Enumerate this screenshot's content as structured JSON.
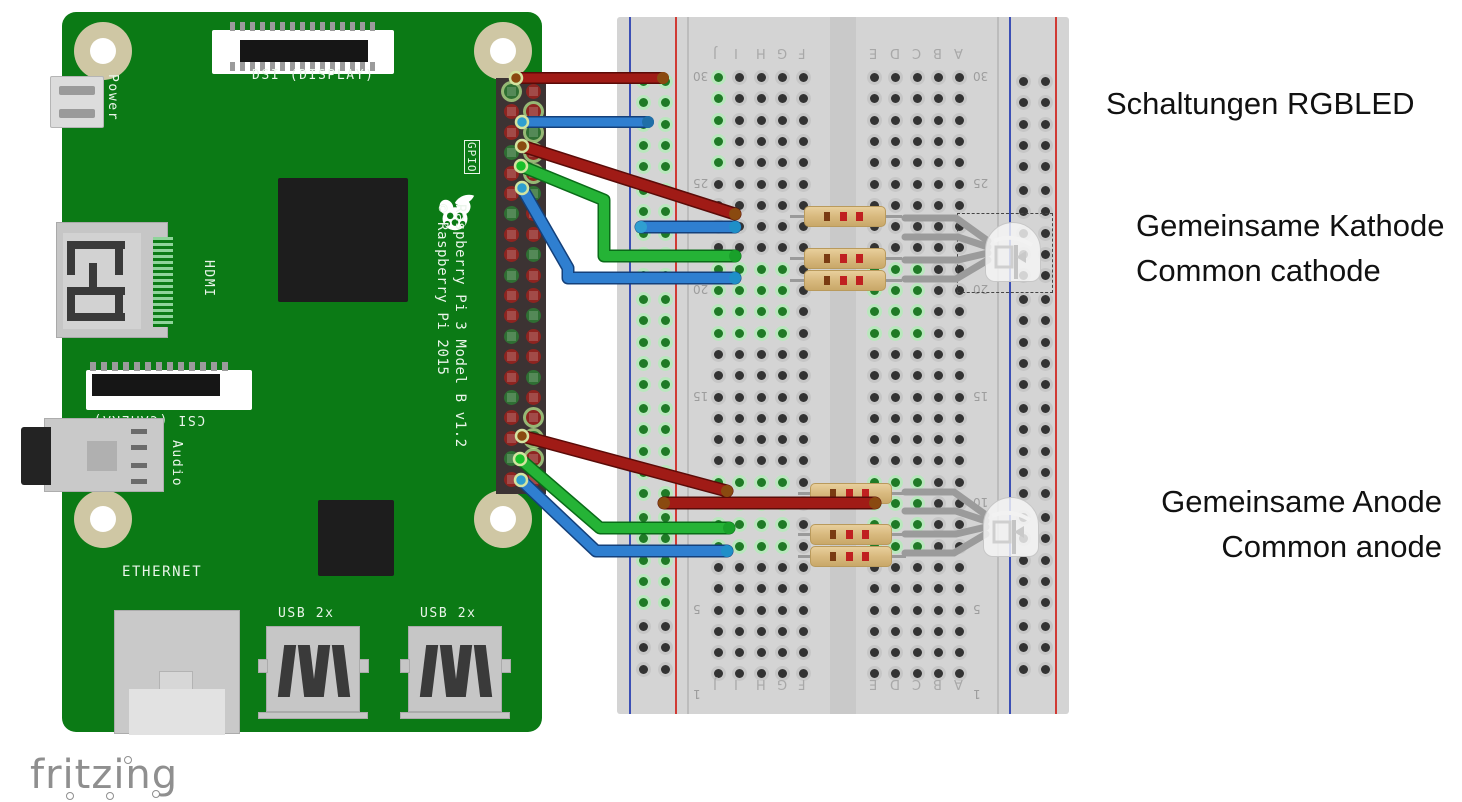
{
  "diagram": {
    "tool": "fritzing",
    "title_caption": "Schaltungen RGBLED"
  },
  "captions": [
    {
      "id": "title",
      "text": "Schaltungen RGBLED",
      "align": "left"
    },
    {
      "id": "cathode_de",
      "text": "Gemeinsame Kathode",
      "align": "left"
    },
    {
      "id": "cathode_en",
      "text": "Common cathode",
      "align": "left"
    },
    {
      "id": "anode_de",
      "text": "Gemeinsame Anode",
      "align": "right"
    },
    {
      "id": "anode_en",
      "text": "Common anode",
      "align": "right"
    }
  ],
  "board": {
    "name": "Raspberry Pi 3 Model B v1.2",
    "copyright": "© Raspberry Pi 2015",
    "silkscreen": {
      "power": "Power",
      "dsi": "DSI (DISPLAY)",
      "hdmi": "HDMI",
      "csi": "CSI (CAMERA)",
      "audio": "Audio",
      "ethernet": "ETHERNET",
      "usb_left": "USB 2x",
      "usb_right": "USB 2x",
      "gpio": "GPIO"
    },
    "pcb_color": "#0b7a15"
  },
  "breadboard": {
    "column_letters_left": [
      "J",
      "I",
      "H",
      "G",
      "F"
    ],
    "column_letters_right": [
      "E",
      "D",
      "C",
      "B",
      "A"
    ],
    "row_numbers": [
      "30",
      "25",
      "20",
      "15",
      "10",
      "5",
      "1"
    ],
    "rail_colors": {
      "negative": "#3b4fb5",
      "positive": "#d03a34"
    },
    "body_color": "#d4d4d4"
  },
  "circuits": [
    {
      "id": "common-cathode",
      "label_de": "Gemeinsame Kathode",
      "label_en": "Common cathode",
      "component": "RGB LED (common cathode)",
      "selected": true,
      "resistor_count": 3,
      "wires": [
        {
          "color": "#8c1410",
          "name": "red-wire-power"
        },
        {
          "color": "#2a6fc4",
          "name": "blue-wire-ground"
        },
        {
          "color": "#8c1410",
          "name": "red-wire-gpio-red"
        },
        {
          "color": "#19a02a",
          "name": "green-wire-gpio-green"
        },
        {
          "color": "#2a6fc4",
          "name": "blue-wire-gpio-blue"
        }
      ]
    },
    {
      "id": "common-anode",
      "label_de": "Gemeinsame Anode",
      "label_en": "Common anode",
      "component": "RGB LED (common anode)",
      "selected": false,
      "resistor_count": 3,
      "wires": [
        {
          "color": "#8c1410",
          "name": "red-wire-anode"
        },
        {
          "color": "#19a02a",
          "name": "green-wire-gpio-green"
        },
        {
          "color": "#2a6fc4",
          "name": "blue-wire-gpio-blue"
        }
      ]
    }
  ],
  "resistor": {
    "bands": [
      "#7a3b12",
      "#c02020",
      "#c02020"
    ],
    "body_color": "#dcc089"
  }
}
